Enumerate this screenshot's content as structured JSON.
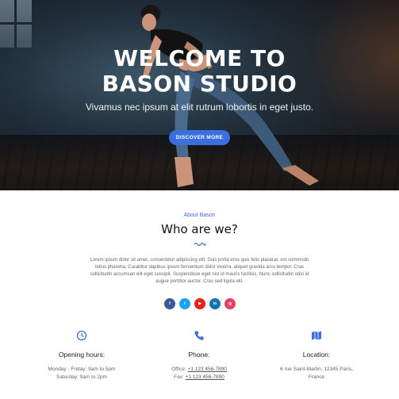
{
  "hero": {
    "title_line1": "WELCOME TO",
    "title_line2": "BASON STUDIO",
    "subtitle": "Vivamus nec ipsum at elit rutrum lobortis in eget justo.",
    "button_label": "DISCOVER MORE"
  },
  "about": {
    "eyebrow": "About Bason",
    "title": "Who are we?",
    "text": "Lorem ipsum dolor sit amet, consectetur adipiscing elit. Duis porta eros quis felis placerat, est commodo tellus pharetra. Curabitur dapibus ipsum fermentum dolor viverra, aliquet gravida arcu tempor. Cras sollicitudin accumsan elit eget suscipit. Suspendisse eget nisl id mauris facilisis. Nunc sollicitudin odio id augue porttitor auctor. Cras sed ligula elit."
  },
  "socials": [
    {
      "icon": "facebook-icon",
      "glyph": "f",
      "color": "#3b5998"
    },
    {
      "icon": "twitter-icon",
      "glyph": "t",
      "color": "#1da1f2"
    },
    {
      "icon": "youtube-icon",
      "glyph": "▶",
      "color": "#e62117"
    },
    {
      "icon": "linkedin-icon",
      "glyph": "in",
      "color": "#0e76a8"
    },
    {
      "icon": "instagram-icon",
      "glyph": "◎",
      "color": "#e4405f"
    }
  ],
  "info": {
    "hours": {
      "icon": "clock-icon",
      "title": "Opening hours:",
      "line1": "Monday - Friday: 9am to 5pm",
      "line2": "Saturday: 9am to 2pm"
    },
    "phone": {
      "icon": "phone-icon",
      "title": "Phone:",
      "line1_label": "Office: ",
      "line1_value": "+1 123 456-7890",
      "line2_label": "Fax: ",
      "line2_value": "+1 123 456-7890"
    },
    "location": {
      "icon": "map-icon",
      "title": "Location:",
      "line1": "6 rue Saint-Martin, 12345 Paris,",
      "line2": "France"
    }
  },
  "colors": {
    "accent": "#3b6fe0"
  }
}
